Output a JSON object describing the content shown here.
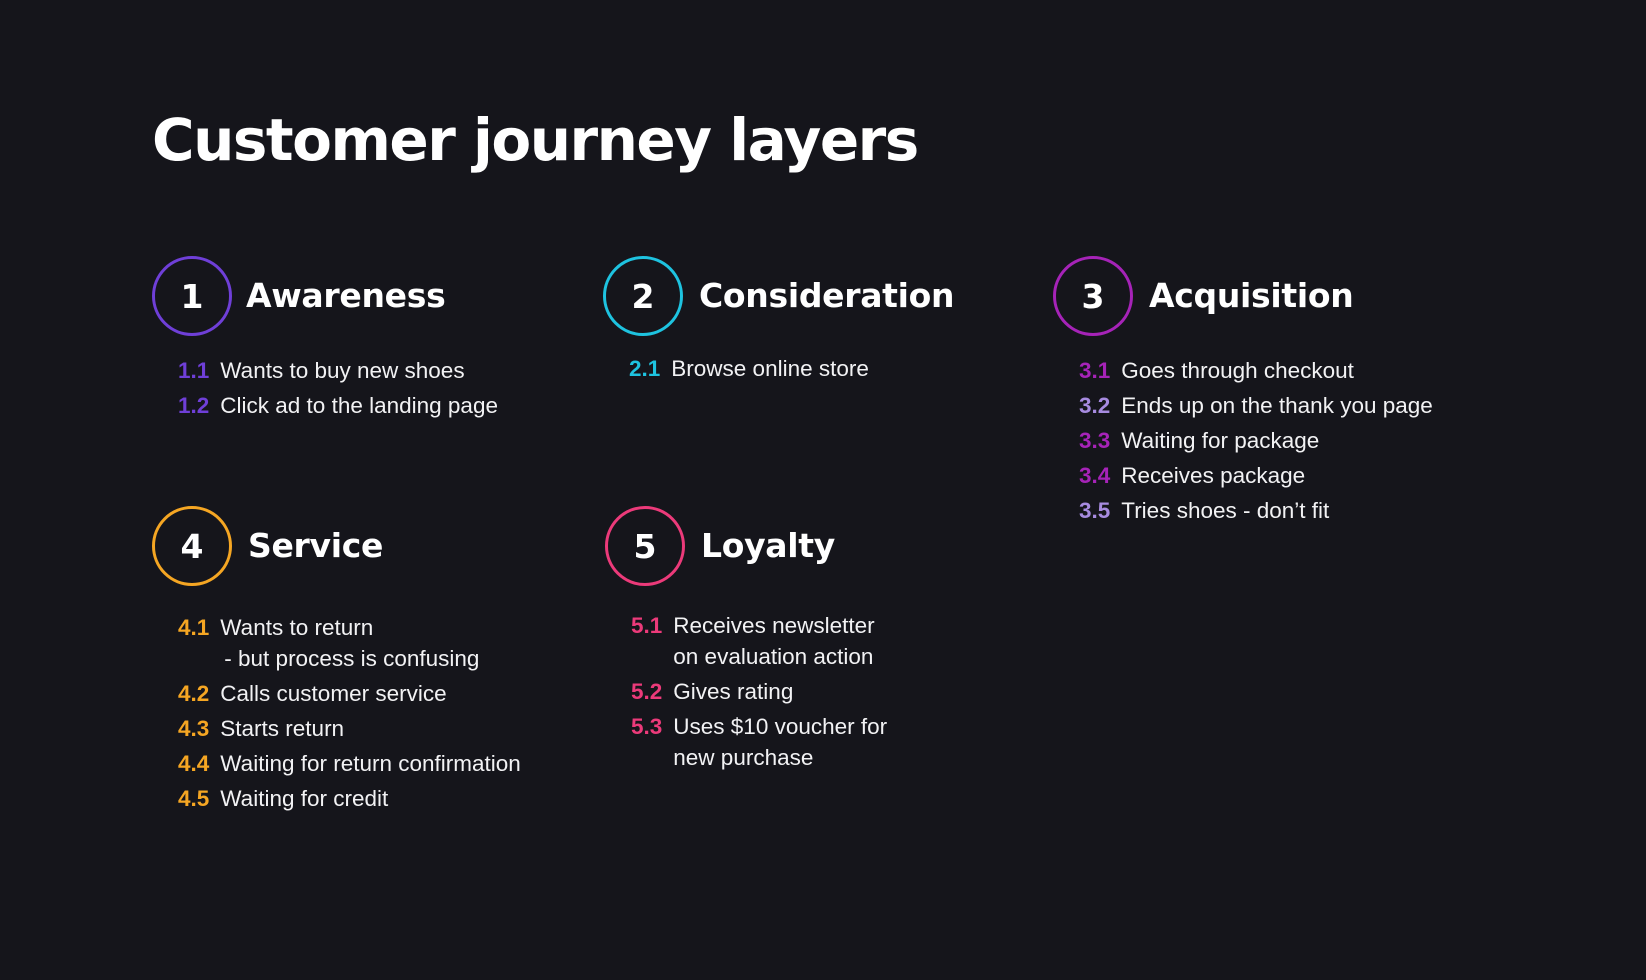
{
  "title": "Customer journey layers",
  "stages": [
    {
      "number": "1",
      "title": "Awareness",
      "color": "#6f3fd8",
      "steps": [
        {
          "num": "1.1",
          "lines": [
            "Wants to buy new shoes"
          ]
        },
        {
          "num": "1.2",
          "lines": [
            "Click ad to the landing page"
          ]
        }
      ]
    },
    {
      "number": "2",
      "title": "Consideration",
      "color": "#1ec3e0",
      "steps": [
        {
          "num": "2.1",
          "lines": [
            "Browse online store"
          ]
        }
      ]
    },
    {
      "number": "3",
      "title": "Acquisition",
      "color": "#a623b8",
      "steps": [
        {
          "num": "3.1",
          "lines": [
            "Goes through checkout"
          ],
          "color": "#a623b8"
        },
        {
          "num": "3.2",
          "lines": [
            "Ends up on the thank you page"
          ],
          "color": "#a78be0"
        },
        {
          "num": "3.3",
          "lines": [
            "Waiting for package"
          ],
          "color": "#a623b8"
        },
        {
          "num": "3.4",
          "lines": [
            "Receives package"
          ],
          "color": "#a623b8"
        },
        {
          "num": "3.5",
          "lines": [
            "Tries shoes - don’t fit"
          ],
          "color": "#a78be0"
        }
      ]
    },
    {
      "number": "4",
      "title": "Service",
      "color": "#f5a623",
      "steps": [
        {
          "num": "4.1",
          "lines": [
            "Wants to return",
            "- but process is confusing"
          ]
        },
        {
          "num": "4.2",
          "lines": [
            "Calls customer service"
          ]
        },
        {
          "num": "4.3",
          "lines": [
            "Starts return"
          ]
        },
        {
          "num": "4.4",
          "lines": [
            "Waiting for return confirmation"
          ]
        },
        {
          "num": "4.5",
          "lines": [
            "Waiting for credit"
          ]
        }
      ]
    },
    {
      "number": "5",
      "title": "Loyalty",
      "color": "#ec3a7a",
      "steps": [
        {
          "num": "5.1",
          "lines": [
            "Receives newsletter",
            "on evaluation action"
          ]
        },
        {
          "num": "5.2",
          "lines": [
            "Gives rating"
          ]
        },
        {
          "num": "5.3",
          "lines": [
            "Uses $10 voucher for",
            "new purchase"
          ]
        }
      ]
    }
  ]
}
